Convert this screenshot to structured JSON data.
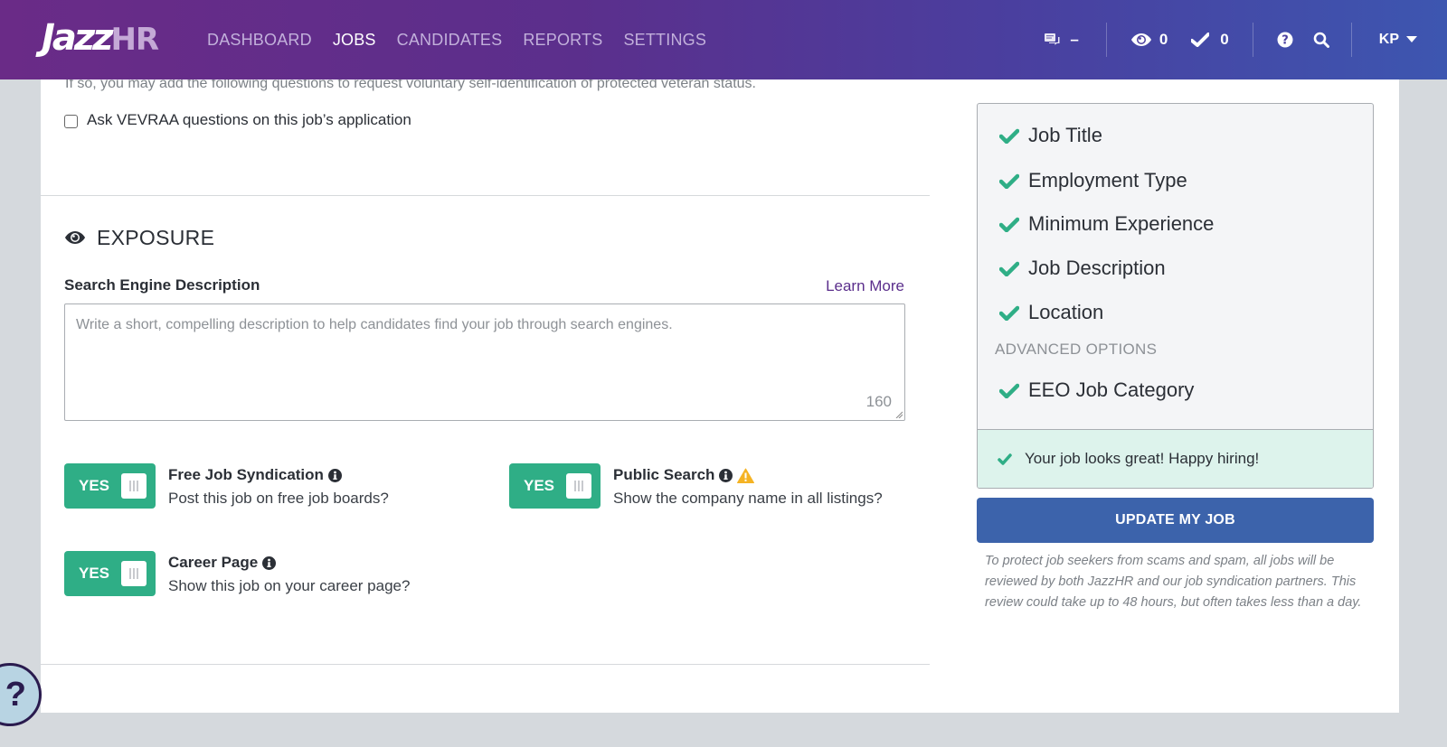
{
  "header": {
    "logo": {
      "part1": "Jazz",
      "part2": "HR"
    },
    "nav": [
      {
        "label": "DASHBOARD",
        "active": false
      },
      {
        "label": "JOBS",
        "active": true
      },
      {
        "label": "CANDIDATES",
        "active": false
      },
      {
        "label": "REPORTS",
        "active": false
      },
      {
        "label": "SETTINGS",
        "active": false
      }
    ],
    "messages_value": "–",
    "views_count": "0",
    "approvals_count": "0",
    "user_initials": "KP"
  },
  "vevraa": {
    "intro": "If so, you may add the following questions to request voluntary self-identification of protected veteran status.",
    "checkbox_label": "Ask VEVRAA questions on this job’s application",
    "checked": false
  },
  "exposure": {
    "title": "EXPOSURE",
    "field_label": "Search Engine Description",
    "learn_more": "Learn More",
    "placeholder": "Write a short, compelling description to help candidates find your job through search engines.",
    "value": "",
    "char_count": "160",
    "toggles": [
      {
        "state": "YES",
        "title": "Free Job Syndication",
        "desc": "Post this job on free job boards?",
        "warning": false
      },
      {
        "state": "YES",
        "title": "Public Search",
        "desc": "Show the company name in all listings?",
        "warning": true
      },
      {
        "state": "YES",
        "title": "Career Page",
        "desc": "Show this job on your career page?",
        "warning": false
      }
    ]
  },
  "checklist": {
    "items": [
      "Job Title",
      "Employment Type",
      "Minimum Experience",
      "Job Description",
      "Location"
    ],
    "advanced_label": "ADVANCED OPTIONS",
    "advanced_items": [
      "EEO Job Category"
    ],
    "success_message": "Your job looks great! Happy hiring!"
  },
  "actions": {
    "update_label": "UPDATE MY JOB",
    "note": "To protect job seekers from scams and spam, all jobs will be reviewed by both JazzHR and our job syndication partners. This review could take up to 48 hours, but often takes less than a day."
  },
  "help": {
    "label": "?"
  },
  "colors": {
    "brand_purple": "#6a2b87",
    "brand_blue": "#3d56b0",
    "toggle_green": "#2fae86",
    "check_green": "#2fae86",
    "button_blue": "#3c63ab",
    "warning_amber": "#f5b324",
    "success_bg": "#ddf3ec"
  }
}
